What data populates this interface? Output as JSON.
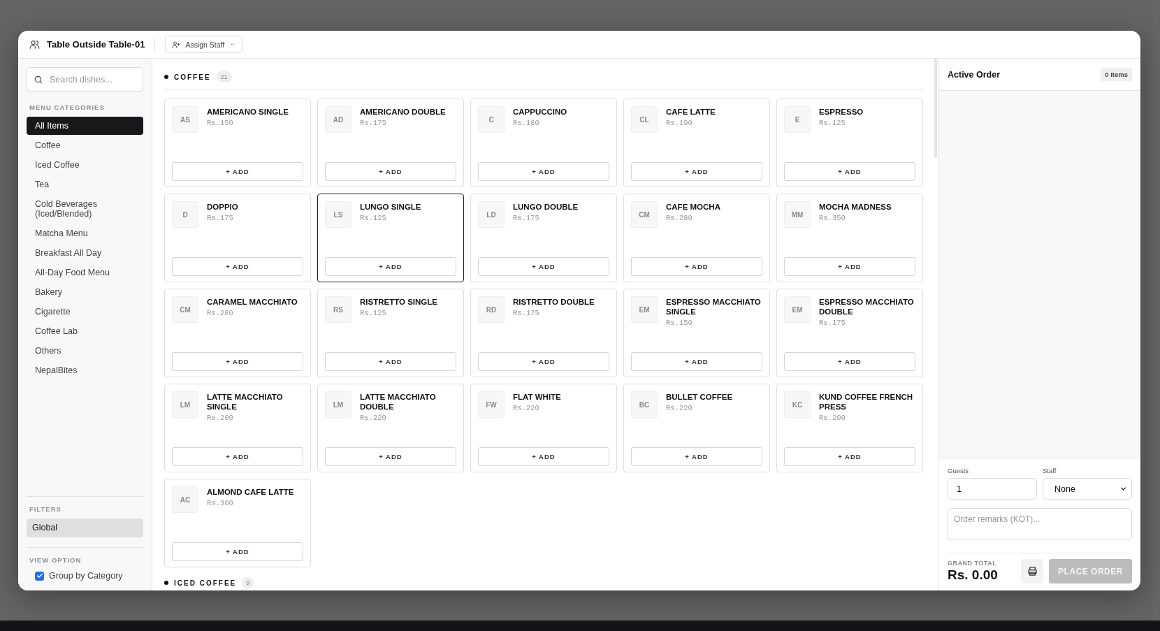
{
  "header": {
    "title": "Table Outside Table-01",
    "assign_button": "Assign Staff"
  },
  "sidebar": {
    "search": {
      "placeholder": "Search dishes..."
    },
    "categories_heading": "MENU CATEGORIES",
    "categories": [
      {
        "label": "All Items",
        "selected": true
      },
      {
        "label": "Coffee",
        "selected": false
      },
      {
        "label": "Iced Coffee",
        "selected": false
      },
      {
        "label": "Tea",
        "selected": false
      },
      {
        "label": "Cold Beverages (Iced/Blended)",
        "selected": false
      },
      {
        "label": "Matcha Menu",
        "selected": false
      },
      {
        "label": "Breakfast All Day",
        "selected": false
      },
      {
        "label": "All-Day Food Menu",
        "selected": false
      },
      {
        "label": "Bakery",
        "selected": false
      },
      {
        "label": "Cigarette",
        "selected": false
      },
      {
        "label": "Coffee Lab",
        "selected": false
      },
      {
        "label": "Others",
        "selected": false
      },
      {
        "label": "NepalBites",
        "selected": false
      }
    ],
    "filters_heading": "FILTERS",
    "filters": [
      {
        "label": "Global",
        "selected": true
      }
    ],
    "view_heading": "VIEW OPTION",
    "view_options": [
      {
        "label": "Group by Category",
        "checked": true
      }
    ]
  },
  "sections": [
    {
      "title": "COFFEE",
      "count": "21",
      "items": [
        {
          "initials": "AS",
          "name": "AMERICANO SINGLE",
          "price": "Rs.150",
          "add": "+ ADD",
          "selected": false
        },
        {
          "initials": "AD",
          "name": "AMERICANO DOUBLE",
          "price": "Rs.175",
          "add": "+ ADD",
          "selected": false
        },
        {
          "initials": "C",
          "name": "CAPPUCCINO",
          "price": "Rs.180",
          "add": "+ ADD",
          "selected": false
        },
        {
          "initials": "CL",
          "name": "CAFE LATTE",
          "price": "Rs.190",
          "add": "+ ADD",
          "selected": false
        },
        {
          "initials": "E",
          "name": "ESPRESSO",
          "price": "Rs.125",
          "add": "+ ADD",
          "selected": false
        },
        {
          "initials": "D",
          "name": "DOPPIO",
          "price": "Rs.175",
          "add": "+ ADD",
          "selected": false
        },
        {
          "initials": "LS",
          "name": "LUNGO SINGLE",
          "price": "Rs.125",
          "add": "+ ADD",
          "selected": true
        },
        {
          "initials": "LD",
          "name": "LUNGO DOUBLE",
          "price": "Rs.175",
          "add": "+ ADD",
          "selected": false
        },
        {
          "initials": "CM",
          "name": "CAFE MOCHA",
          "price": "Rs.280",
          "add": "+ ADD",
          "selected": false
        },
        {
          "initials": "MM",
          "name": "MOCHA MADNESS",
          "price": "Rs.350",
          "add": "+ ADD",
          "selected": false
        },
        {
          "initials": "CM",
          "name": "CARAMEL MACCHIATO",
          "price": "Rs.280",
          "add": "+ ADD",
          "selected": false
        },
        {
          "initials": "RS",
          "name": "RISTRETTO SINGLE",
          "price": "Rs.125",
          "add": "+ ADD",
          "selected": false
        },
        {
          "initials": "RD",
          "name": "RISTRETTO DOUBLE",
          "price": "Rs.175",
          "add": "+ ADD",
          "selected": false
        },
        {
          "initials": "EM",
          "name": "ESPRESSO MACCHIATO SINGLE",
          "price": "Rs.150",
          "add": "+ ADD",
          "selected": false
        },
        {
          "initials": "EM",
          "name": "ESPRESSO MACCHIATO DOUBLE",
          "price": "Rs.175",
          "add": "+ ADD",
          "selected": false
        },
        {
          "initials": "LM",
          "name": "LATTE MACCHIATO SINGLE",
          "price": "Rs.200",
          "add": "+ ADD",
          "selected": false
        },
        {
          "initials": "LM",
          "name": "LATTE MACCHIATO DOUBLE",
          "price": "Rs.220",
          "add": "+ ADD",
          "selected": false
        },
        {
          "initials": "FW",
          "name": "FLAT WHITE",
          "price": "Rs.220",
          "add": "+ ADD",
          "selected": false
        },
        {
          "initials": "BC",
          "name": "BULLET COFFEE",
          "price": "Rs.220",
          "add": "+ ADD",
          "selected": false
        },
        {
          "initials": "KC",
          "name": "KUND COFFEE FRENCH PRESS",
          "price": "Rs.200",
          "add": "+ ADD",
          "selected": false
        },
        {
          "initials": "AC",
          "name": "ALMOND CAFE LATTE",
          "price": "Rs.300",
          "add": "+ ADD",
          "selected": false
        }
      ]
    },
    {
      "title": "ICED COFFEE",
      "count": "9"
    }
  ],
  "order": {
    "title": "Active Order",
    "count": "0 Items",
    "guests_label": "Guests",
    "guests": "1",
    "staff_label": "Staff",
    "staff": "None",
    "remarks": {
      "placeholder": "Order remarks (KOT)..."
    },
    "total_label": "GRAND TOTAL",
    "total": "Rs. 0.00",
    "place_button": {
      "label": "PLACE ORDER",
      "disabled": true
    }
  }
}
